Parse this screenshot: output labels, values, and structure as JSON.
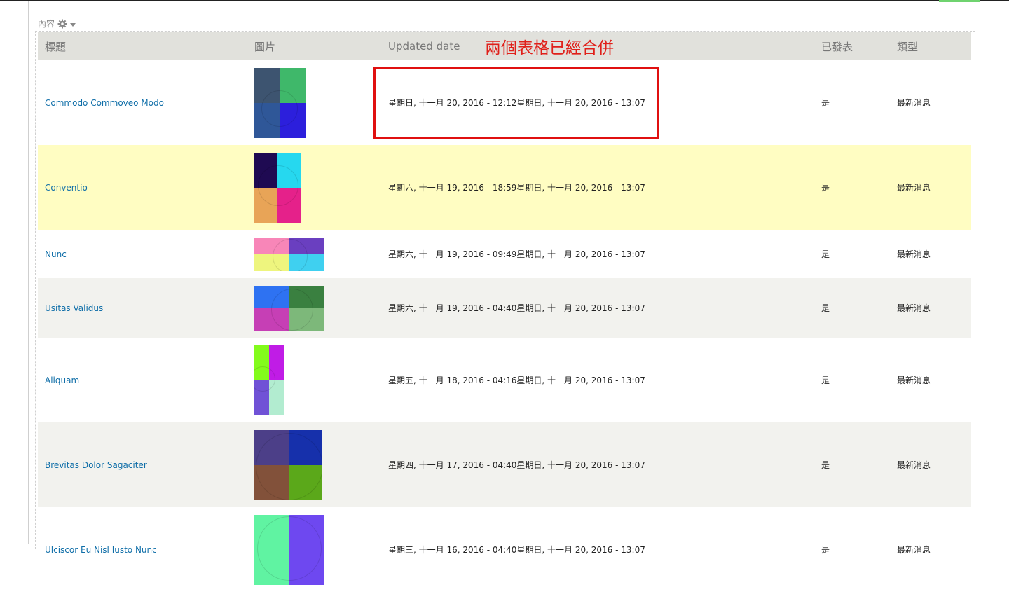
{
  "region_label": "內容",
  "columns": [
    "標題",
    "圖片",
    "Updated date",
    "已發表",
    "類型"
  ],
  "annotation": "兩個表格已經合併",
  "rows": [
    {
      "title": "Commodo Commoveo Modo",
      "date": "星期日, 十一月 20, 2016 - 12:12星期日, 十一月 20, 2016 - 13:07",
      "published": "是",
      "type": "最新消息",
      "colors": [
        "#3d5470",
        "#3fb86a",
        "#2f5798",
        "#2c1fdc"
      ]
    },
    {
      "title": "Conventio",
      "date": "星期六, 十一月 19, 2016 - 18:59星期日, 十一月 20, 2016 - 13:07",
      "published": "是",
      "type": "最新消息",
      "colors": [
        "#1f0a52",
        "#26d8ef",
        "#e8a457",
        "#e5218a"
      ]
    },
    {
      "title": "Nunc",
      "date": "星期六, 十一月 19, 2016 - 09:49星期日, 十一月 20, 2016 - 13:07",
      "published": "是",
      "type": "最新消息",
      "colors": [
        "#f886b8",
        "#6a3fc0",
        "#eef57e",
        "#3fd0f0"
      ]
    },
    {
      "title": "Usitas Validus",
      "date": "星期六, 十一月 19, 2016 - 04:40星期日, 十一月 20, 2016 - 13:07",
      "published": "是",
      "type": "最新消息",
      "colors": [
        "#2e72f2",
        "#3a8040",
        "#c63fb5",
        "#7db87a"
      ]
    },
    {
      "title": "Aliquam",
      "date": "星期五, 十一月 18, 2016 - 04:16星期日, 十一月 20, 2016 - 13:07",
      "published": "是",
      "type": "最新消息",
      "colors": [
        "#83fb1c",
        "#c01ce6",
        "#7052d6",
        "#b2ecd0"
      ]
    },
    {
      "title": "Brevitas Dolor Sagaciter",
      "date": "星期四, 十一月 17, 2016 - 04:40星期日, 十一月 20, 2016 - 13:07",
      "published": "是",
      "type": "最新消息",
      "colors": [
        "#4c3f88",
        "#1630ab",
        "#82513a",
        "#5ba81a"
      ]
    },
    {
      "title": "Ulciscor Eu Nisl Iusto Nunc",
      "date": "星期三, 十一月 16, 2016 - 04:40星期日, 十一月 20, 2016 - 13:07",
      "published": "是",
      "type": "最新消息",
      "colors": [
        "#60f3a2",
        "#6e48f0",
        "#60f3a2",
        "#6e48f0"
      ]
    }
  ]
}
